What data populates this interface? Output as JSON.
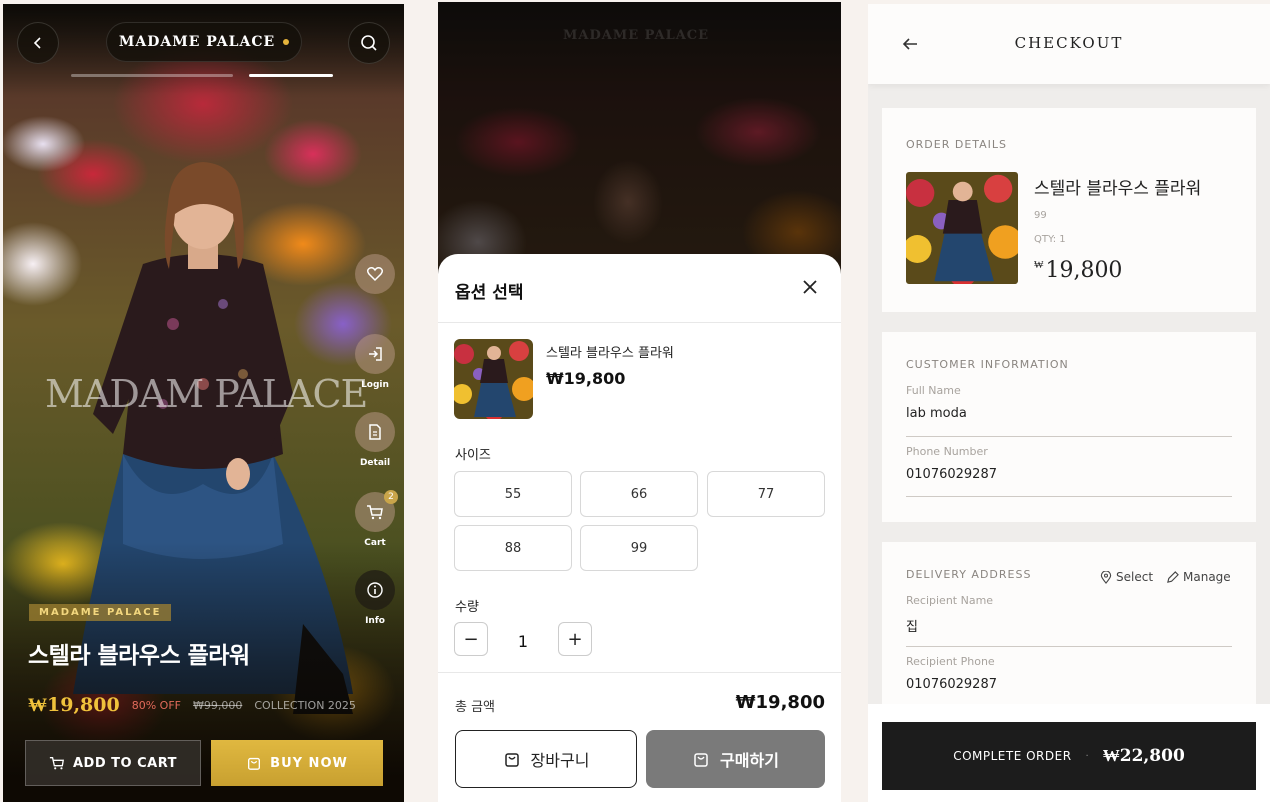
{
  "detail": {
    "brand": "MADAME PALACE",
    "watermark": "MADAM PALACE",
    "side_buttons": [
      {
        "icon": "heart-icon",
        "label": ""
      },
      {
        "icon": "login-icon",
        "label": "Login"
      },
      {
        "icon": "document-icon",
        "label": "Detail"
      },
      {
        "icon": "cart-icon",
        "label": "Cart",
        "badge": "2"
      },
      {
        "icon": "info-icon",
        "label": "Info"
      }
    ],
    "brand_tag": "MADAME PALACE",
    "product_name": "스텔라 블라우스 플라워",
    "price": "₩19,800",
    "discount": "80% OFF",
    "original_price": "₩99,000",
    "collection": "COLLECTION 2025",
    "add_to_cart": "ADD TO CART",
    "buy_now": "BUY NOW",
    "colors": {
      "accent": "#e0b840",
      "indicator_active": "#ffffff"
    }
  },
  "options": {
    "header_brand": "MADAME PALACE",
    "title": "옵션 선택",
    "product_name": "스텔라 블라우스 플라워",
    "price": "₩19,800",
    "size_label": "사이즈",
    "sizes": [
      "55",
      "66",
      "77",
      "88",
      "99"
    ],
    "qty_label": "수량",
    "qty": "1",
    "qty_minus": "−",
    "qty_plus": "+",
    "total_label": "총 금액",
    "total": "₩19,800",
    "cart_btn": "장바구니",
    "buy_btn": "구매하기"
  },
  "checkout": {
    "title": "CHECKOUT",
    "order_details": {
      "heading": "ORDER DETAILS",
      "product_name": "스텔라 블라우스 플라워",
      "size": "99",
      "qty": "QTY: 1",
      "currency": "₩",
      "price": "19,800"
    },
    "customer": {
      "heading": "CUSTOMER INFORMATION",
      "name_label": "Full Name",
      "name": "lab moda",
      "phone_label": "Phone Number",
      "phone": "01076029287"
    },
    "delivery": {
      "heading": "DELIVERY ADDRESS",
      "select": "Select",
      "manage": "Manage",
      "recipient_label": "Recipient Name",
      "recipient": "집",
      "recipient_phone_label": "Recipient Phone",
      "recipient_phone": "01076029287"
    },
    "complete_label": "COMPLETE ORDER",
    "separator": "·",
    "complete_total": "₩22,800"
  }
}
